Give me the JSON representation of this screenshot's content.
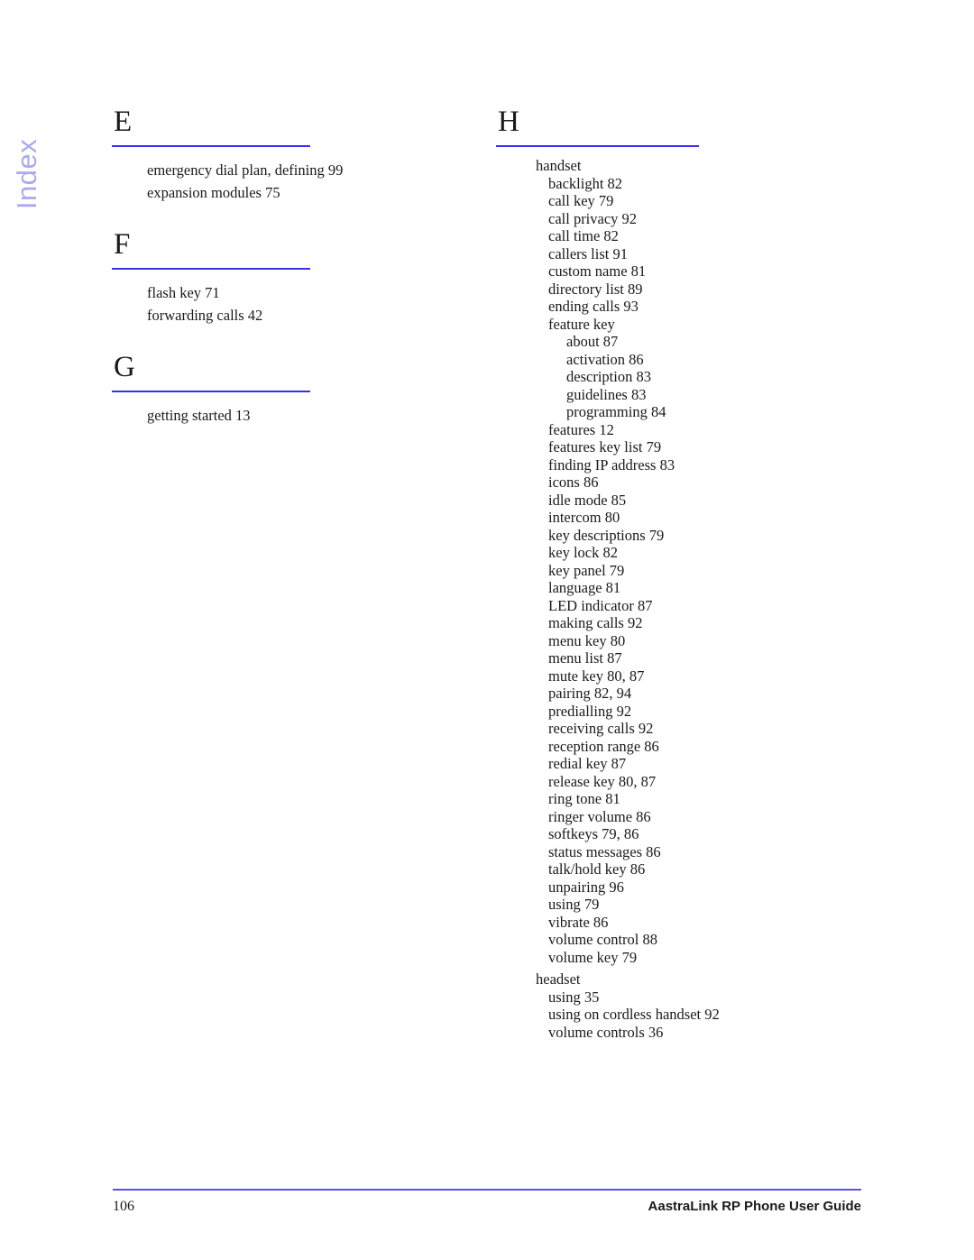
{
  "document": {
    "side_tab_label": "Index",
    "accent_rule_color": "#3a30ea",
    "side_tab_color": "#a9aaf0",
    "text_color": "#1a1a1a"
  },
  "left_column": {
    "groups": [
      {
        "letter": "E",
        "entries": [
          {
            "text": "emergency dial plan, defining 99",
            "level": 1
          },
          {
            "text": "expansion modules 75",
            "level": 1
          }
        ]
      },
      {
        "letter": "F",
        "entries": [
          {
            "text": "flash key 71",
            "level": 1
          },
          {
            "text": "forwarding calls 42",
            "level": 1
          }
        ]
      },
      {
        "letter": "G",
        "entries": [
          {
            "text": "getting started 13",
            "level": 1
          }
        ]
      }
    ]
  },
  "right_column": {
    "groups": [
      {
        "letter": "H",
        "entries": [
          {
            "text": "handset",
            "level": 1
          },
          {
            "text": "backlight 82",
            "level": 2
          },
          {
            "text": "call key 79",
            "level": 2
          },
          {
            "text": "call privacy 92",
            "level": 2
          },
          {
            "text": "call time 82",
            "level": 2
          },
          {
            "text": "callers list 91",
            "level": 2
          },
          {
            "text": "custom name 81",
            "level": 2
          },
          {
            "text": "directory list 89",
            "level": 2
          },
          {
            "text": "ending calls 93",
            "level": 2
          },
          {
            "text": "feature key",
            "level": 2
          },
          {
            "text": "about 87",
            "level": 3
          },
          {
            "text": "activation 86",
            "level": 3
          },
          {
            "text": "description 83",
            "level": 3
          },
          {
            "text": "guidelines 83",
            "level": 3
          },
          {
            "text": "programming 84",
            "level": 3
          },
          {
            "text": "features 12",
            "level": 2
          },
          {
            "text": "features key list 79",
            "level": 2
          },
          {
            "text": "finding IP address 83",
            "level": 2
          },
          {
            "text": "icons 86",
            "level": 2
          },
          {
            "text": "idle mode 85",
            "level": 2
          },
          {
            "text": "intercom 80",
            "level": 2
          },
          {
            "text": "key descriptions 79",
            "level": 2
          },
          {
            "text": "key lock 82",
            "level": 2
          },
          {
            "text": "key panel 79",
            "level": 2
          },
          {
            "text": "language 81",
            "level": 2
          },
          {
            "text": "LED indicator 87",
            "level": 2
          },
          {
            "text": "making calls 92",
            "level": 2
          },
          {
            "text": "menu key 80",
            "level": 2
          },
          {
            "text": "menu list 87",
            "level": 2
          },
          {
            "text": "mute key 80, 87",
            "level": 2
          },
          {
            "text": "pairing 82, 94",
            "level": 2
          },
          {
            "text": "predialling 92",
            "level": 2
          },
          {
            "text": "receiving calls 92",
            "level": 2
          },
          {
            "text": "reception range 86",
            "level": 2
          },
          {
            "text": "redial key 87",
            "level": 2
          },
          {
            "text": "release key 80, 87",
            "level": 2
          },
          {
            "text": "ring tone 81",
            "level": 2
          },
          {
            "text": "ringer volume 86",
            "level": 2
          },
          {
            "text": "softkeys 79, 86",
            "level": 2
          },
          {
            "text": "status messages 86",
            "level": 2
          },
          {
            "text": "talk/hold key 86",
            "level": 2
          },
          {
            "text": "unpairing 96",
            "level": 2
          },
          {
            "text": "using 79",
            "level": 2
          },
          {
            "text": "vibrate 86",
            "level": 2
          },
          {
            "text": "volume control 88",
            "level": 2
          },
          {
            "text": "volume key 79",
            "level": 2
          },
          {
            "text": "headset",
            "level": 1,
            "gap": true
          },
          {
            "text": "using 35",
            "level": 2
          },
          {
            "text": "using on cordless handset 92",
            "level": 2
          },
          {
            "text": "volume controls 36",
            "level": 2
          }
        ]
      }
    ]
  },
  "footer": {
    "page_number": "106",
    "title": "AastraLink RP Phone User Guide"
  }
}
